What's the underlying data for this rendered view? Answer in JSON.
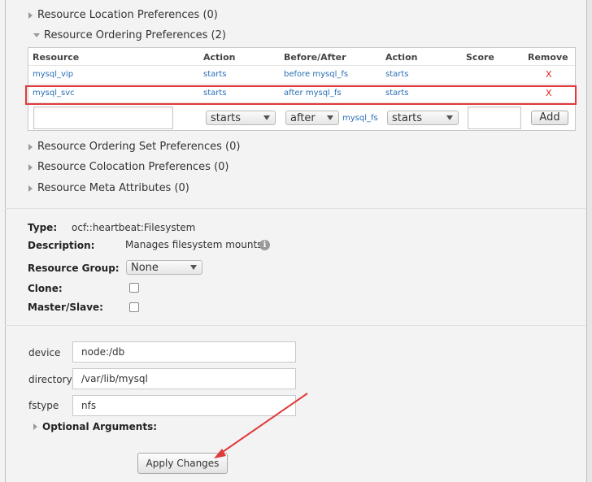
{
  "preferences": {
    "location": "Resource Location Preferences (0)",
    "ordering": "Resource Ordering Preferences (2)",
    "ordering_set": "Resource Ordering Set Preferences (0)",
    "colocation": "Resource Colocation Preferences (0)",
    "meta": "Resource Meta Attributes (0)"
  },
  "ordering_table": {
    "headers": [
      "Resource",
      "Action",
      "Before/After",
      "Action",
      "Score",
      "Remove"
    ],
    "rows": [
      {
        "resource": "mysql_vip",
        "action": "starts",
        "before_after": "before mysql_fs",
        "action2": "starts",
        "score": "",
        "remove": "X"
      },
      {
        "resource": "mysql_svc",
        "action": "starts",
        "before_after": "after mysql_fs",
        "action2": "starts",
        "score": "",
        "remove": "X"
      }
    ],
    "new_row": {
      "resource_value": "",
      "action_value": "starts",
      "before_after_value": "after",
      "target": "mysql_fs",
      "action2_value": "starts",
      "score_value": "",
      "add_label": "Add"
    }
  },
  "details": {
    "type_label": "Type:",
    "type_value": "ocf::heartbeat:Filesystem",
    "description_label": "Description:",
    "description_value": "Manages filesystem mounts",
    "group_label": "Resource Group:",
    "group_value": "None",
    "clone_label": "Clone:",
    "masterslave_label": "Master/Slave:"
  },
  "arguments": [
    {
      "name": "device",
      "value": "node:/db"
    },
    {
      "name": "directory",
      "value": "/var/lib/mysql"
    },
    {
      "name": "fstype",
      "value": "nfs"
    }
  ],
  "optional_args_label": "Optional Arguments:",
  "apply_label": "Apply Changes",
  "colors": {
    "link": "#2a6fb4",
    "highlight": "#e03a3a",
    "remove": "#e02020"
  }
}
